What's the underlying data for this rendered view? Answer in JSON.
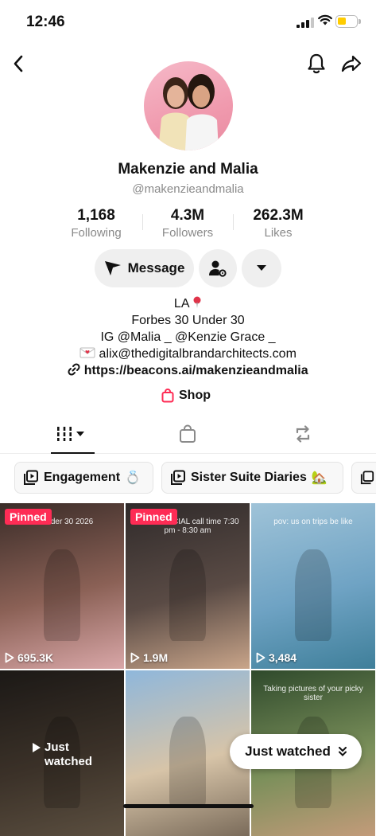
{
  "status": {
    "time": "12:46"
  },
  "profile": {
    "display_name": "Makenzie and Malia",
    "username": "@makenzieandmalia",
    "stats": [
      {
        "value": "1,168",
        "label": "Following"
      },
      {
        "value": "4.3M",
        "label": "Followers"
      },
      {
        "value": "262.3M",
        "label": "Likes"
      }
    ],
    "message_label": "Message",
    "bio": {
      "location": "LA",
      "line2": "Forbes 30 Under 30",
      "line3": "IG @Malia _ @Kenzie Grace _",
      "email": "alix@thedigitalbrandarchitects.com",
      "link": "https://beacons.ai/makenzieandmalia"
    },
    "shop_label": "Shop"
  },
  "playlists": [
    {
      "label": "Engagement",
      "emoji": "💍"
    },
    {
      "label": "Sister Suite Diaries",
      "emoji": "🏡"
    }
  ],
  "videos": [
    {
      "pinned": "Pinned",
      "views": "695.3K",
      "overlay_text": "30 under 30 2026",
      "colors": [
        "#3a2c28",
        "#8b6156",
        "#d9a7a8"
      ]
    },
    {
      "pinned": "Pinned",
      "views": "1.9M",
      "overlay_text": "COMMERCIAL call time 7:30 pm - 8:30 am",
      "colors": [
        "#2f2a2a",
        "#5a4b45",
        "#c9a58a"
      ]
    },
    {
      "views": "3,484",
      "overlay_text": "pov: us on trips be like",
      "colors": [
        "#9fc3d8",
        "#6fa3c4",
        "#3f7f9a"
      ]
    },
    {
      "just_watched": "Just watched",
      "colors": [
        "#2b2622",
        "#5c4d3f",
        "#8d7a63"
      ]
    },
    {
      "colors": [
        "#8fb7db",
        "#d7c4a8",
        "#7a6b5a"
      ]
    },
    {
      "overlay_text": "Taking pictures of your picky sister",
      "colors": [
        "#2f4a2c",
        "#7a8f5a",
        "#c39b7a"
      ]
    }
  ],
  "just_watched_button": "Just watched"
}
